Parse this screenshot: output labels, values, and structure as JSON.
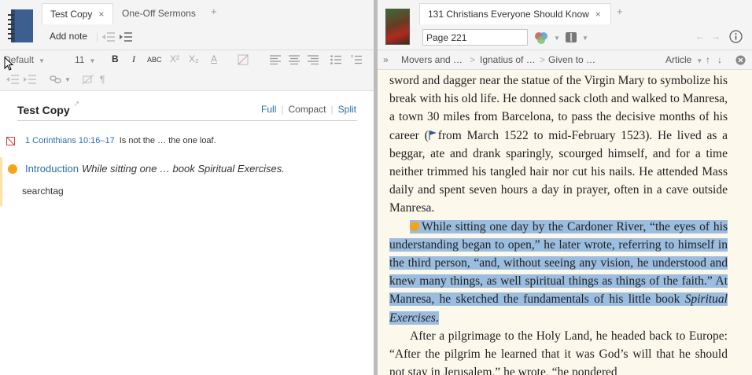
{
  "left": {
    "tabs": [
      {
        "label": "Test Copy",
        "close": "×"
      },
      {
        "label": "One-Off Sermons"
      }
    ],
    "tab_plus": "+",
    "add_note": "Add note",
    "format": {
      "style": "Default",
      "size": "11",
      "bold": "B",
      "italic": "I",
      "smallcaps": "ABC",
      "superscript": "X²",
      "subscript": "X₂",
      "font_color": "A",
      "paragraph": "¶"
    },
    "document": {
      "title": "Test Copy",
      "views": {
        "full": "Full",
        "compact": "Compact",
        "split": "Split"
      }
    },
    "notes": [
      {
        "ref": "1 Corinthians 10:16–17",
        "text": "Is not the … the one loaf."
      },
      {
        "anchor": "Introduction",
        "quote": "While sitting one … book Spiritual Exercises.",
        "tag": "searchtag"
      }
    ]
  },
  "right": {
    "tabs": [
      {
        "label": "131 Christians Everyone Should Know",
        "close": "×"
      }
    ],
    "tab_plus": "+",
    "page_value": "Page 221",
    "breadcrumbs": [
      "Movers and …",
      "Ignatius of …",
      "Given to …"
    ],
    "section_menu": "Article",
    "reader": {
      "p1": "sword and dagger near the statue of the Virgin Mary to symbolize his break with his old life. He donned sack cloth and walked to Manresa, a town 30 miles from Barcelona, to pass the decisive months of his career (",
      "p1b": "from March 1522 to mid-February 1523). He lived as a beggar, ate and drank sparingly, scourged himself, and for a time neither trimmed his tangled hair nor cut his nails. He attended Mass daily and spent seven hours a day in prayer, often in a cave outside Manresa.",
      "p2": "While sitting one day by the Cardoner River, “the eyes of his understanding began to open,” he later wrote, referring to himself in the third person, “and, without seeing any vision, he understood and knew many things, as well spiritual things as things of the faith.” At Manresa, he sketched the fundamentals of his little book ",
      "p2_em": "Spiritual Exercises",
      "p2_end": ".",
      "p3": "After a pilgrimage to the Holy Land, he headed back to Europe: “After the pilgrim he learned that it was God’s will that he should not stay in Jerusalem,” he wrote, “he pondered"
    }
  },
  "colors": {
    "accent": "#2a6fa8",
    "highlight": "#9bbde0",
    "note_dot": "#f5a31a",
    "reader_bg": "#fdf8ec"
  }
}
